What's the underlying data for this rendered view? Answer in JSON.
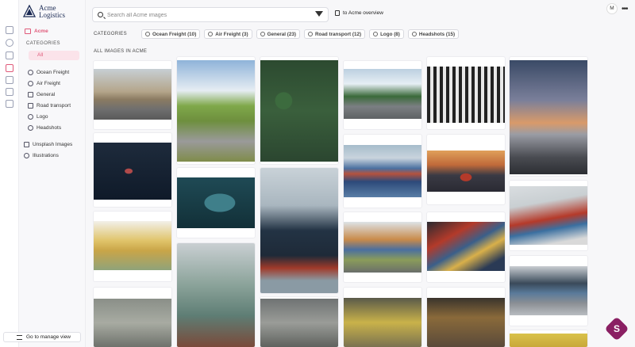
{
  "brand": {
    "name_line1": "Acme",
    "name_line2": "Logistics"
  },
  "sidebar": {
    "library": "Acme",
    "categories_label": "CATEGORIES",
    "all_label": "All",
    "items": [
      {
        "label": "Ocean Freight",
        "icon": "globe-icon"
      },
      {
        "label": "Air Freight",
        "icon": "plane-icon"
      },
      {
        "label": "General",
        "icon": "box-icon"
      },
      {
        "label": "Road transport",
        "icon": "truck-icon"
      },
      {
        "label": "Logo",
        "icon": "logo-icon"
      },
      {
        "label": "Headshots",
        "icon": "user-icon"
      }
    ],
    "extras": [
      {
        "label": "Unsplash Images",
        "icon": "image-icon"
      },
      {
        "label": "Illustrations",
        "icon": "pen-icon"
      }
    ],
    "manage": "Go to manage view"
  },
  "search": {
    "placeholder": "Search all Acme images"
  },
  "overview": "to Acme overview",
  "avatar": "M",
  "more": "•••",
  "categories_label": "CATEGORIES",
  "chips": [
    {
      "label": "Ocean Freight (10)",
      "icon": "globe-icon"
    },
    {
      "label": "Air Freight (3)",
      "icon": "plane-icon"
    },
    {
      "label": "General (23)",
      "icon": "box-icon"
    },
    {
      "label": "Road transport (12)",
      "icon": "truck-icon"
    },
    {
      "label": "Logo (8)",
      "icon": "logo-icon"
    },
    {
      "label": "Headshots (15)",
      "icon": "user-icon"
    }
  ],
  "all_images_label": "ALL IMAGES IN ACME",
  "badge": "S",
  "colors": {
    "accent": "#e05a7a",
    "brand": "#1c2b55",
    "badge": "#8a1f63"
  }
}
